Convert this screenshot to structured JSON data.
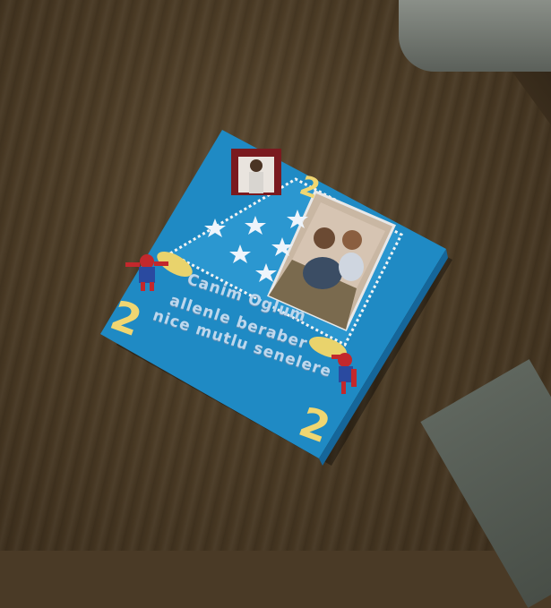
{
  "cake": {
    "message_line1": "Canim Oglum",
    "message_line2": "allenle beraber",
    "message_line3": "nice mutlu senelere",
    "number_left": "2",
    "number_right": "2",
    "number_top": "2",
    "photo_caption": ""
  },
  "colors": {
    "cake_blue": "#1f8ac4",
    "number_yellow": "#f0d671",
    "table_wood": "#4b3b25"
  }
}
